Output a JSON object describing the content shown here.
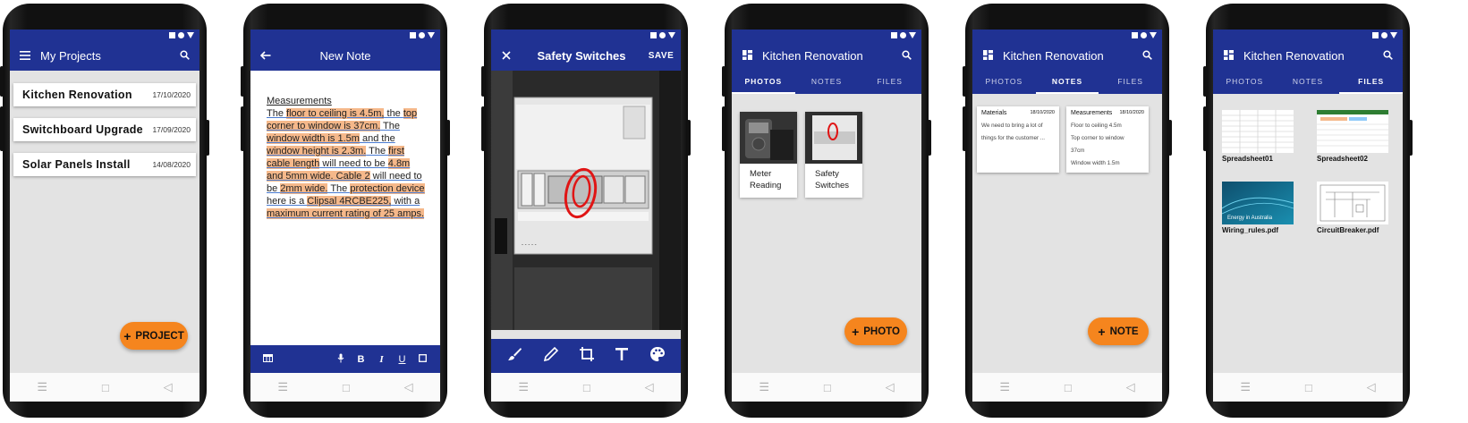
{
  "projects_screen": {
    "title": "My Projects",
    "projects": [
      {
        "name": "Kitchen Renovation",
        "date": "17/10/2020"
      },
      {
        "name": "Switchboard Upgrade",
        "date": "17/09/2020"
      },
      {
        "name": "Solar Panels Install",
        "date": "14/08/2020"
      }
    ],
    "fab_label": "PROJECT"
  },
  "note_screen": {
    "title": "New Note",
    "heading": "Measurements",
    "body": [
      {
        "t": "The ",
        "h": false
      },
      {
        "t": "floor to ceiling is 4.5m,",
        "h": true
      },
      {
        "t": " the ",
        "h": false
      },
      {
        "t": "top corner to window is 37cm.",
        "h": true
      },
      {
        "t": " The ",
        "h": false
      },
      {
        "t": "window width is 1.5m",
        "h": true
      },
      {
        "t": " and the ",
        "h": false
      },
      {
        "t": "window height is 2.3m.",
        "h": true
      },
      {
        "t": " The ",
        "h": false
      },
      {
        "t": "first cable length",
        "h": true
      },
      {
        "t": " will need to be ",
        "h": false
      },
      {
        "t": "4.8m and 5mm wide. Cable 2",
        "h": true
      },
      {
        "t": " will need to be ",
        "h": false
      },
      {
        "t": "2mm wide.",
        "h": true
      },
      {
        "t": " The ",
        "h": false
      },
      {
        "t": "protection device",
        "h": true
      },
      {
        "t": " here is a ",
        "h": false
      },
      {
        "t": "Clipsal 4RCBE225,",
        "h": true
      },
      {
        "t": " with a ",
        "h": false
      },
      {
        "t": "maximum current rating of 25 amps.",
        "h": true
      }
    ],
    "toolbar": {
      "table_icon": "table-icon",
      "mic_icon": "mic-icon",
      "bold": "B",
      "italic": "I",
      "underline": "U",
      "checkbox_icon": "checkbox-icon"
    }
  },
  "edit_screen": {
    "title": "Safety Switches",
    "save_label": "SAVE",
    "tools": [
      "brush-icon",
      "pencil-icon",
      "crop-icon",
      "text-icon",
      "palette-icon"
    ]
  },
  "photos_screen": {
    "title": "Kitchen Renovation",
    "tabs": [
      "PHOTOS",
      "NOTES",
      "FILES"
    ],
    "active_tab": "PHOTOS",
    "photos": [
      {
        "caption_line1": "Meter",
        "caption_line2": "Reading"
      },
      {
        "caption_line1": "Safety",
        "caption_line2": "Switches"
      }
    ],
    "fab_label": "PHOTO"
  },
  "notes_screen": {
    "title": "Kitchen Renovation",
    "tabs": [
      "PHOTOS",
      "NOTES",
      "FILES"
    ],
    "active_tab": "NOTES",
    "notes": [
      {
        "title": "Materials",
        "date": "18/10/2020",
        "preview": "We need to bring a lot of things for the customer ..."
      },
      {
        "title": "Measurements",
        "date": "18/10/2020",
        "lines": [
          "Floor to ceiling 4.5m",
          "Top corner to window",
          "37cm",
          "Window width 1.5m"
        ]
      }
    ],
    "fab_label": "NOTE"
  },
  "files_screen": {
    "title": "Kitchen Renovation",
    "tabs": [
      "PHOTOS",
      "NOTES",
      "FILES"
    ],
    "active_tab": "FILES",
    "files": [
      "Spreadsheet01",
      "Spreadsheet02",
      "Wiring_rules.pdf",
      "CircuitBreaker.pdf"
    ],
    "thumb_text": "Energy in Australia"
  },
  "colors": {
    "primary": "#203293",
    "accent": "#f5851e",
    "highlight": "#f5b88a"
  }
}
